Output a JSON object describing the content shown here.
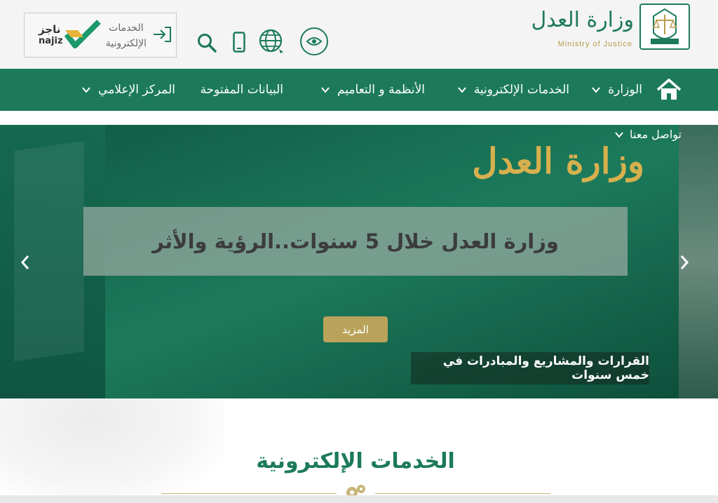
{
  "header": {
    "logo_ar": "وزارة العدل",
    "logo_en": "Ministry of Justice",
    "eservices_line1": "الخدمات",
    "eservices_line2": "الإلكترونية",
    "najiz_ar": "ناجز",
    "najiz_en": "najiz"
  },
  "nav": {
    "items": [
      {
        "label": "الوزارة"
      },
      {
        "label": "الخدمات الإلكترونية"
      },
      {
        "label": "الأنظمة و التعاميم"
      },
      {
        "label": "البيانات المفتوحة"
      },
      {
        "label": "المركز الإعلامي"
      }
    ]
  },
  "banner": {
    "contact_label": "تواصل معنا",
    "logo_ar": "وزارة العدل",
    "caption": "وزارة العدل خلال 5 سنوات..الرؤية والأثر",
    "more_button": "المزيد",
    "sub_caption": "القرارات والمشاريع والمبادرات  في خمس سنوات"
  },
  "section": {
    "title": "الخدمات الإلكترونية"
  },
  "colors": {
    "primary": "#1c7a5b",
    "gold": "#b9a35a",
    "header_bg": "#f4f4f4"
  },
  "icons": {
    "home": "home-icon",
    "eye": "eye-icon",
    "globe": "globe-icon",
    "mobile": "mobile-icon",
    "search": "search-icon",
    "login": "login-arrow-icon",
    "chevron": "chevron-down-icon"
  }
}
